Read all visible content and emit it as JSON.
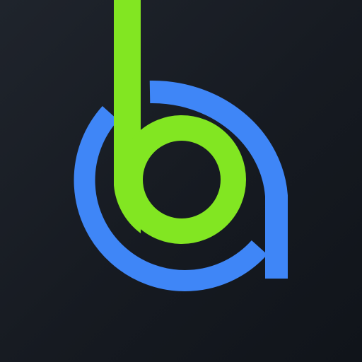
{
  "logo": {
    "icon": "ba-monogram-logo",
    "colors": {
      "background": "#161a21",
      "green": "#82e622",
      "blue": "#3f86f7"
    }
  }
}
